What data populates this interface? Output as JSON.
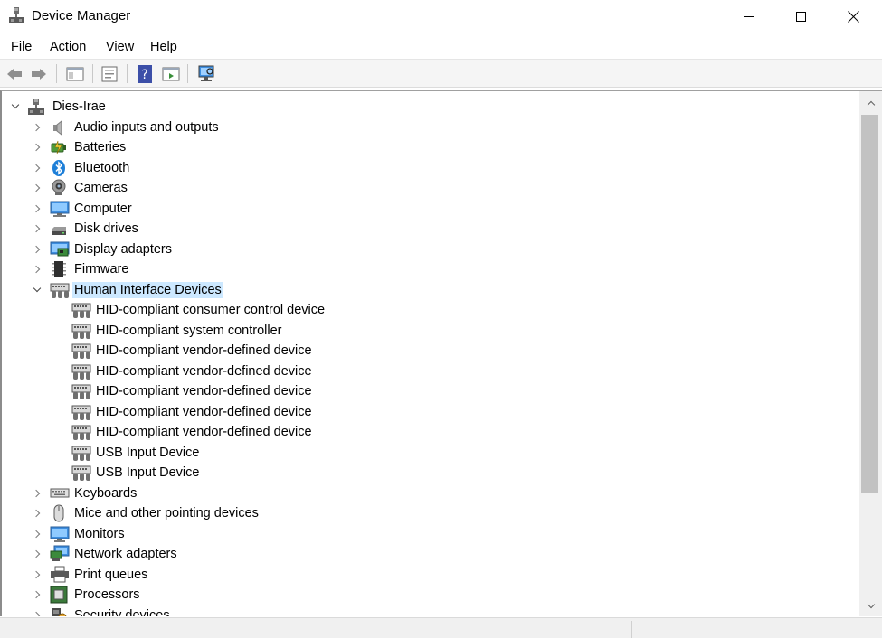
{
  "window": {
    "title": "Device Manager",
    "controls": {
      "minimize": "minimize",
      "maximize": "maximize",
      "close": "close"
    }
  },
  "menu": {
    "file": "File",
    "action": "Action",
    "view": "View",
    "help": "Help"
  },
  "toolbar": {
    "buttons": [
      "back-icon",
      "forward-icon",
      "show-hide-console-tree-icon",
      "properties-icon",
      "help-icon",
      "run-action-icon",
      "scan-hardware-changes-icon"
    ]
  },
  "tree": {
    "root": {
      "label": "Dies-Irae",
      "expanded": true
    },
    "categories": [
      {
        "label": "Audio inputs and outputs",
        "icon": "speaker-icon",
        "expanded": false
      },
      {
        "label": "Batteries",
        "icon": "battery-icon",
        "expanded": false
      },
      {
        "label": "Bluetooth",
        "icon": "bluetooth-icon",
        "expanded": false
      },
      {
        "label": "Cameras",
        "icon": "camera-icon",
        "expanded": false
      },
      {
        "label": "Computer",
        "icon": "computer-icon",
        "expanded": false
      },
      {
        "label": "Disk drives",
        "icon": "disk-drive-icon",
        "expanded": false
      },
      {
        "label": "Display adapters",
        "icon": "display-adapter-icon",
        "expanded": false
      },
      {
        "label": "Firmware",
        "icon": "firmware-chip-icon",
        "expanded": false
      },
      {
        "label": "Human Interface Devices",
        "icon": "hid-icon",
        "expanded": true,
        "selected": true,
        "children": [
          "HID-compliant consumer control device",
          "HID-compliant system controller",
          "HID-compliant vendor-defined device",
          "HID-compliant vendor-defined device",
          "HID-compliant vendor-defined device",
          "HID-compliant vendor-defined device",
          "HID-compliant vendor-defined device",
          "USB Input Device",
          "USB Input Device"
        ]
      },
      {
        "label": "Keyboards",
        "icon": "keyboard-icon",
        "expanded": false
      },
      {
        "label": "Mice and other pointing devices",
        "icon": "mouse-icon",
        "expanded": false
      },
      {
        "label": "Monitors",
        "icon": "monitor-icon",
        "expanded": false
      },
      {
        "label": "Network adapters",
        "icon": "network-adapter-icon",
        "expanded": false
      },
      {
        "label": "Print queues",
        "icon": "printer-icon",
        "expanded": false
      },
      {
        "label": "Processors",
        "icon": "processor-icon",
        "expanded": false
      },
      {
        "label": "Security devices",
        "icon": "security-device-icon",
        "expanded": false
      }
    ]
  },
  "colors": {
    "selection": "#cce8ff",
    "accent_blue": "#1e7fd8"
  }
}
